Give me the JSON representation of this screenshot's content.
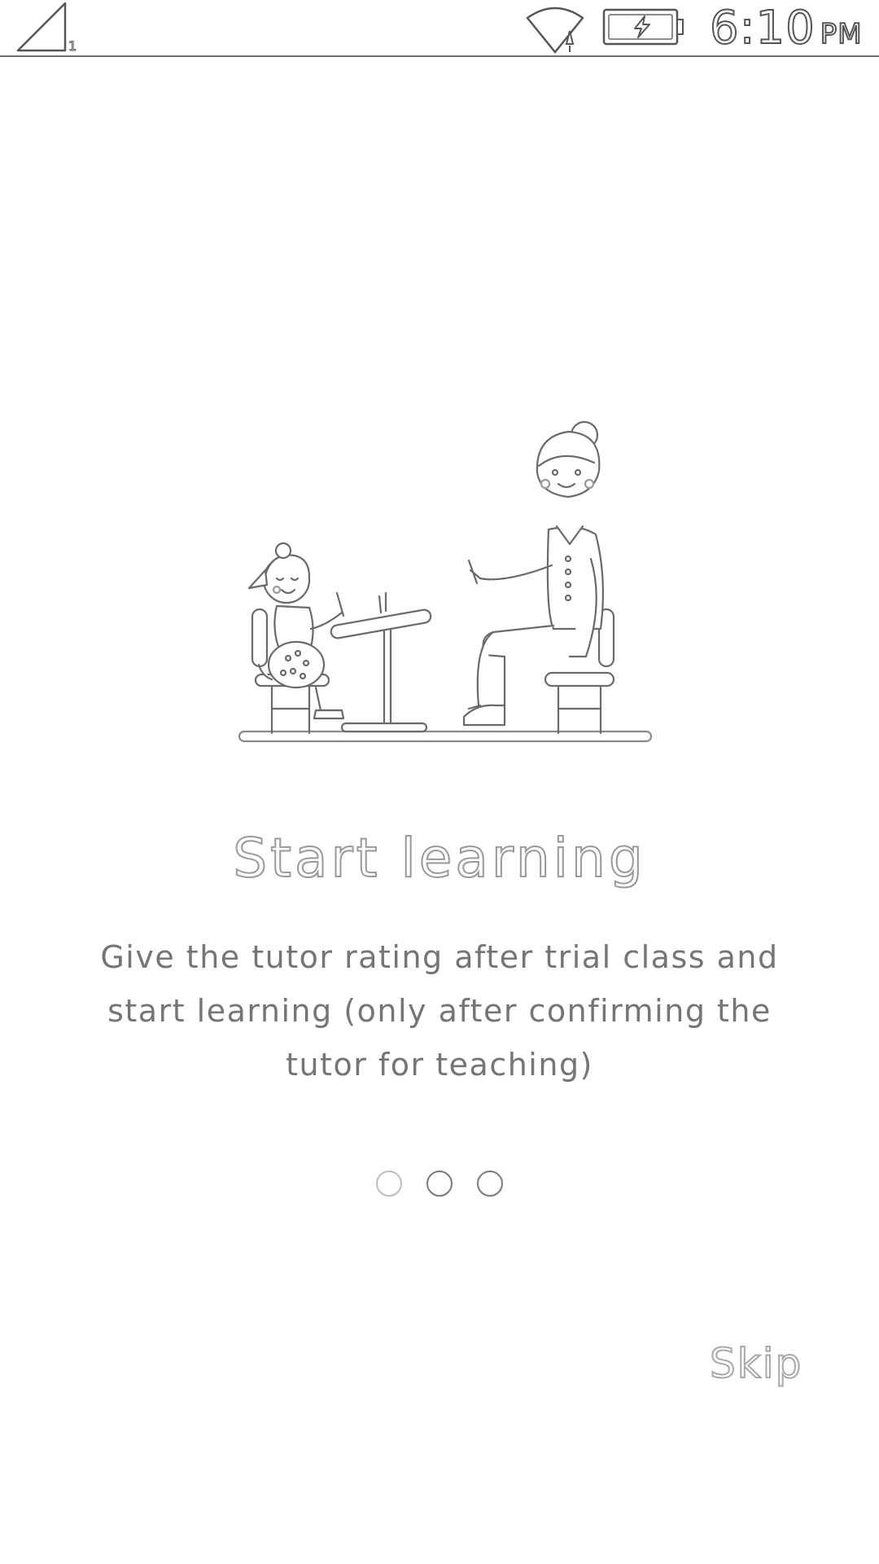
{
  "status_bar": {
    "signal_icon": "cellular-signal-icon",
    "sim_label": "1",
    "wifi_icon": "wifi-icon",
    "battery_icon": "battery-charging-icon",
    "time": "6:10",
    "ampm": "PM"
  },
  "onboarding": {
    "illustration": "tutor-and-child-at-desk-illustration",
    "title": "Start learning",
    "description": "Give the tutor rating after trial class and start learning (only after confirming the tutor for teaching)",
    "page_indicator": {
      "total": 3,
      "current": 1
    },
    "skip_label": "Skip"
  }
}
